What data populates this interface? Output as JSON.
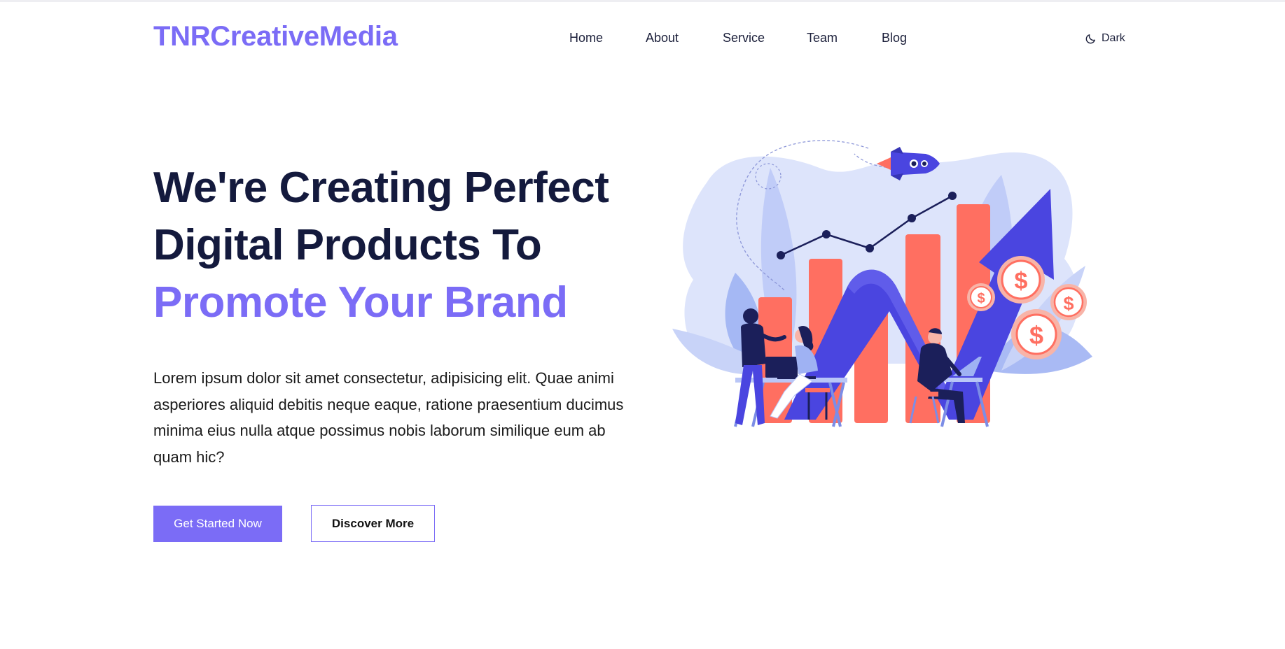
{
  "header": {
    "logo": "TNRCreativeMedia",
    "nav": [
      {
        "label": "Home"
      },
      {
        "label": "About"
      },
      {
        "label": "Service"
      },
      {
        "label": "Team"
      },
      {
        "label": "Blog"
      }
    ],
    "theme_toggle": {
      "label": "Dark",
      "icon": "moon-icon"
    }
  },
  "hero": {
    "title_line1": "We're Creating Perfect",
    "title_line2": "Digital Products To",
    "title_accent": "Promote Your Brand",
    "description": "Lorem ipsum dolor sit amet consectetur, adipisicing elit. Quae animi asperiores aliquid debitis neque eaque, ratione praesentium ducimus minima eius nulla atque possimus nobis laborum similique eum ab quam hic?",
    "primary_button": "Get Started Now",
    "secondary_button": "Discover More",
    "coin_symbol": "$"
  },
  "colors": {
    "accent": "#7b6cf6",
    "heading": "#141a3d",
    "bar": "#ff6f61",
    "arrow": "#4a45e0",
    "blob": "#dde4fb"
  }
}
